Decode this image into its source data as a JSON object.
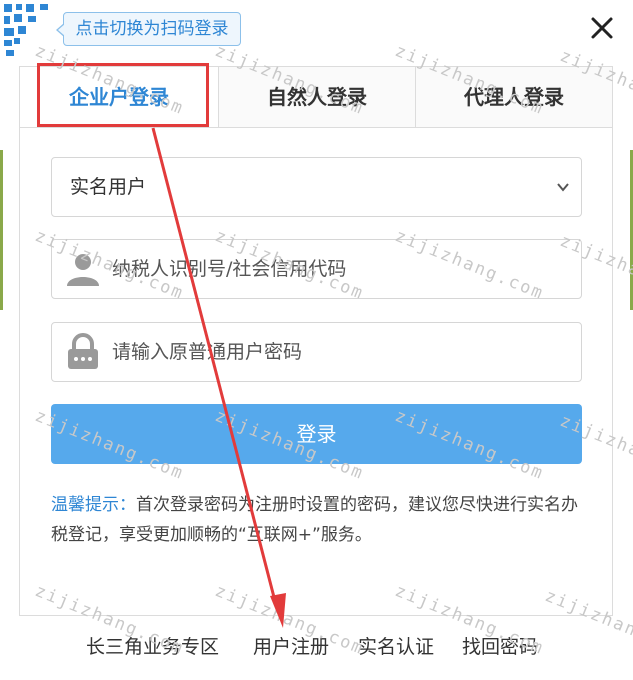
{
  "qr_tip": "点击切换为扫码登录",
  "tabs": [
    {
      "label": "企业户登录"
    },
    {
      "label": "自然人登录"
    },
    {
      "label": "代理人登录"
    }
  ],
  "form": {
    "user_type_value": "实名用户",
    "taxid_placeholder": "纳税人识别号/社会信用代码",
    "password_placeholder": "请输入原普通用户密码",
    "login_label": "登录"
  },
  "tip": {
    "label": "温馨提示：",
    "text": "首次登录密码为注册时设置的密码，建议您尽快进行实名办税登记，享受更加顺畅的“互联网+”服务。"
  },
  "footer": [
    {
      "label": "长三角业务专区"
    },
    {
      "label": "用户注册"
    },
    {
      "label": "实名认证"
    },
    {
      "label": "找回密码"
    }
  ],
  "watermark": "zijizhang.com",
  "colors": {
    "accent": "#2e86d4",
    "button": "#56a9ec",
    "annotation": "#e23b3b"
  }
}
